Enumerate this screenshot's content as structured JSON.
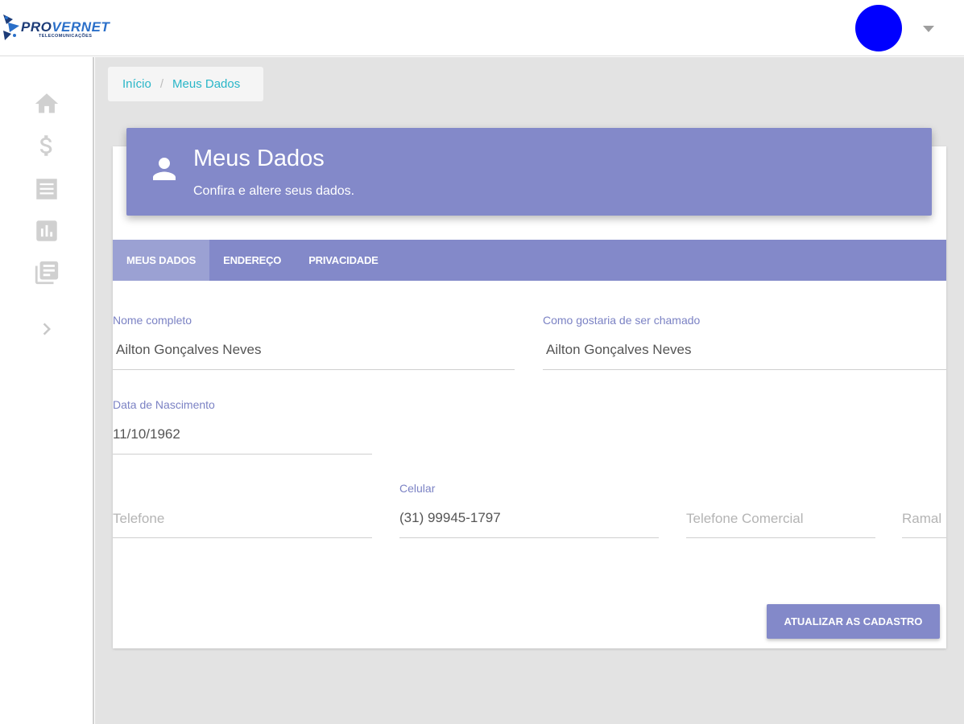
{
  "brand": {
    "name_part1": "PRO",
    "name_part2": "VERNET",
    "tagline": "TELECOMUNICAÇÕES"
  },
  "header": {
    "avatar_color": "#0000ff"
  },
  "sidebar": {
    "items": [
      {
        "icon": "home-icon"
      },
      {
        "icon": "dollar-icon"
      },
      {
        "icon": "list-icon"
      },
      {
        "icon": "bar-chart-icon"
      },
      {
        "icon": "library-books-icon"
      },
      {
        "icon": "chevron-right-icon"
      }
    ]
  },
  "breadcrumb": {
    "home": "Início",
    "separator": "/",
    "current": "Meus Dados"
  },
  "card": {
    "title": "Meus Dados",
    "subtitle": "Confira e altere seus dados."
  },
  "tabs": [
    {
      "label": "MEUS DADOS",
      "active": true
    },
    {
      "label": "ENDEREÇO",
      "active": false
    },
    {
      "label": "PRIVACIDADE",
      "active": false
    }
  ],
  "form": {
    "full_name": {
      "label": "Nome completo",
      "value": "Ailton Gonçalves Neves"
    },
    "nickname": {
      "label": "Como gostaria de ser chamado",
      "value": "Ailton Gonçalves Neves"
    },
    "birth_date": {
      "label": "Data de Nascimento",
      "value": "11/10/1962"
    },
    "phone": {
      "placeholder": "Telefone"
    },
    "mobile": {
      "label": "Celular",
      "value": "(31) 99945-1797"
    },
    "business_phone": {
      "placeholder": "Telefone Comercial"
    },
    "extension": {
      "placeholder": "Ramal"
    }
  },
  "submit_label": "ATUALIZAR AS CADASTRO",
  "colors": {
    "primary": "#8389c9",
    "accent": "#29b6c8",
    "background": "#e3e3e3"
  }
}
